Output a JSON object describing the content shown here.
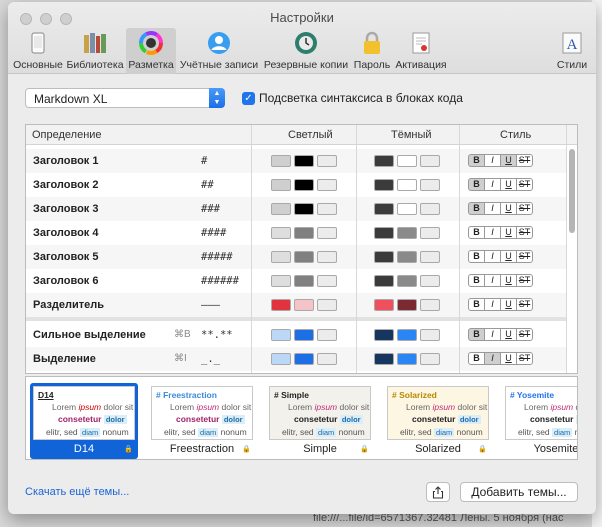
{
  "window": {
    "title": "Настройки"
  },
  "toolbar": [
    {
      "label": "Основные",
      "icon": "phone-icon"
    },
    {
      "label": "Библиотека",
      "icon": "books-icon"
    },
    {
      "label": "Разметка",
      "icon": "color-wheel-icon",
      "active": true
    },
    {
      "label": "Учётные записи",
      "icon": "user-icon"
    },
    {
      "label": "Резервные копии",
      "icon": "backup-clock-icon"
    },
    {
      "label": "Пароль",
      "icon": "lock-icon"
    },
    {
      "label": "Активация",
      "icon": "certificate-icon"
    },
    {
      "label": "Стили",
      "icon": "font-icon"
    }
  ],
  "markup_select": {
    "value": "Markdown XL"
  },
  "syntax_checkbox": {
    "label": "Подсветка синтаксиса в блоках кода",
    "checked": true
  },
  "table": {
    "headers": [
      "Определение",
      "Светлый",
      "Тёмный",
      "Стиль"
    ],
    "style_labels": [
      "B",
      "I",
      "U",
      "ST"
    ],
    "rows": [
      {
        "name": "Заголовок 1",
        "shortcut": "",
        "markup": "#",
        "light": [
          "#cfcfcf",
          "#000000",
          "#ececec"
        ],
        "dark": [
          "#3b3b3b",
          "#ffffff",
          "#ececec"
        ],
        "style": [
          1,
          0,
          1,
          0
        ]
      },
      {
        "name": "Заголовок 2",
        "shortcut": "",
        "markup": "##",
        "light": [
          "#cfcfcf",
          "#000000",
          "#ececec"
        ],
        "dark": [
          "#3b3b3b",
          "#ffffff",
          "#ececec"
        ],
        "style": [
          1,
          0,
          0,
          0
        ]
      },
      {
        "name": "Заголовок 3",
        "shortcut": "",
        "markup": "###",
        "light": [
          "#cfcfcf",
          "#000000",
          "#ececec"
        ],
        "dark": [
          "#3b3b3b",
          "#ffffff",
          "#ececec"
        ],
        "style": [
          1,
          0,
          0,
          0
        ]
      },
      {
        "name": "Заголовок 4",
        "shortcut": "",
        "markup": "####",
        "light": [
          "#dedede",
          "#808080",
          "#ececec"
        ],
        "dark": [
          "#3b3b3b",
          "#8a8a8a",
          "#ececec"
        ],
        "style": [
          0,
          0,
          0,
          0
        ]
      },
      {
        "name": "Заголовок 5",
        "shortcut": "",
        "markup": "#####",
        "light": [
          "#dedede",
          "#808080",
          "#ececec"
        ],
        "dark": [
          "#3b3b3b",
          "#8a8a8a",
          "#ececec"
        ],
        "style": [
          0,
          0,
          0,
          0
        ]
      },
      {
        "name": "Заголовок 6",
        "shortcut": "",
        "markup": "######",
        "light": [
          "#dedede",
          "#808080",
          "#ececec"
        ],
        "dark": [
          "#3b3b3b",
          "#8a8a8a",
          "#ececec"
        ],
        "style": [
          0,
          0,
          0,
          0
        ]
      },
      {
        "name": "Разделитель",
        "shortcut": "",
        "markup": "–––",
        "light": [
          "#e0333d",
          "#f4c4c8",
          "#ececec"
        ],
        "dark": [
          "#f0505e",
          "#7a2a30",
          "#ececec"
        ],
        "style": [
          0,
          0,
          0,
          0
        ]
      },
      {
        "name": "Сильное выделение",
        "shortcut": "⌘B",
        "markup": "**.**",
        "light": [
          "#bcd8f7",
          "#1d6fe6",
          "#ececec"
        ],
        "dark": [
          "#16365f",
          "#2a86f5",
          "#ececec"
        ],
        "style": [
          1,
          0,
          0,
          0
        ]
      },
      {
        "name": "Выделение",
        "shortcut": "⌘I",
        "markup": "_._",
        "light": [
          "#bcd8f7",
          "#1d6fe6",
          "#ececec"
        ],
        "dark": [
          "#16365f",
          "#2a86f5",
          "#ececec"
        ],
        "style": [
          0,
          1,
          0,
          0
        ]
      }
    ]
  },
  "themes": [
    {
      "name": "D14",
      "heading": "D14",
      "selected": true,
      "bg": "#ffffff"
    },
    {
      "name": "Freestraction",
      "heading": "# Freestraction",
      "selected": false,
      "bg": "#ffffff"
    },
    {
      "name": "Simple",
      "heading": "# Simple",
      "selected": false,
      "bg": "#f3f1ec"
    },
    {
      "name": "Solarized",
      "heading": "# Solarized",
      "selected": false,
      "bg": "#fdf6e3"
    },
    {
      "name": "Yosemite",
      "heading": "# Yosemite",
      "selected": false,
      "bg": "#ffffff"
    }
  ],
  "theme_preview": {
    "line1": "Lorem",
    "emph": "ipsum",
    "rest1": "dolor sit",
    "strong": "consetetur",
    "tag": "dolor",
    "line3": "elitr, sed",
    "tag2": "diam",
    "rest3": "nonum"
  },
  "footer": {
    "more_link": "Скачать ещё темы...",
    "add_button": "Добавить темы..."
  },
  "background": {
    "text": "file:///...file/id=6571367.32481 Лены. 5 ноября (нас"
  },
  "colors": {
    "accent": "#1f75ea",
    "selection": "#1163d8"
  }
}
